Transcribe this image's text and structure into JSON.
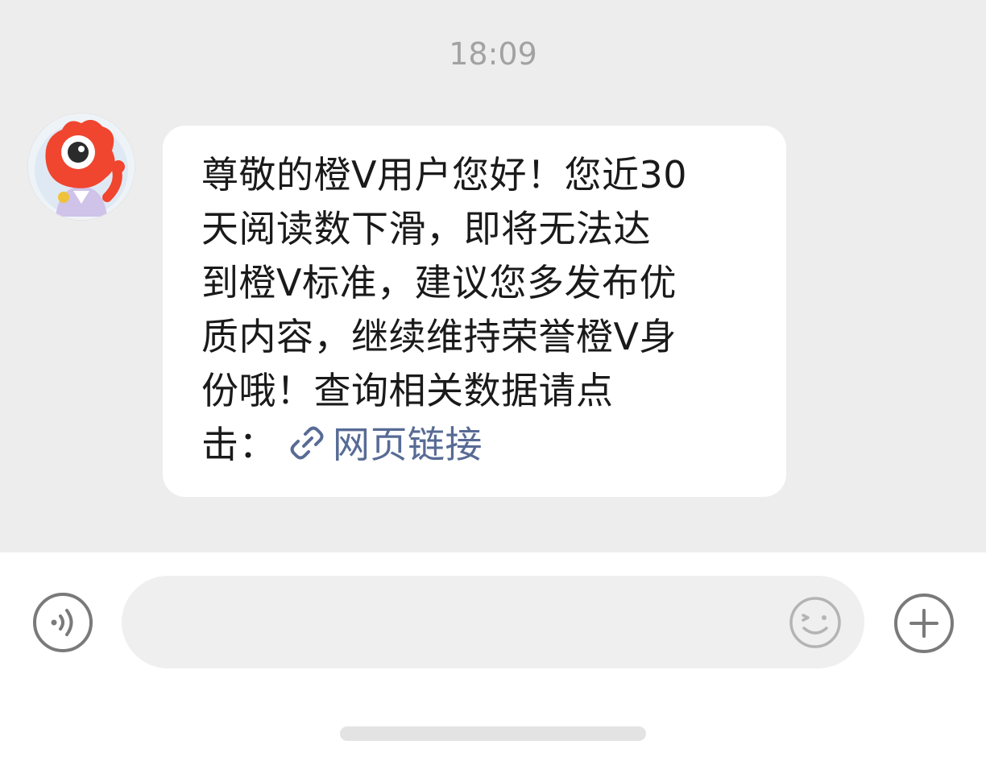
{
  "chat": {
    "timestamp": "18:09",
    "message": {
      "lines": [
        "尊敬的橙V用户您好！您近30",
        "天阅读数下滑，即将无法达",
        "到橙V标准，建议您多发布优",
        "质内容，继续维持荣誉橙V身",
        "份哦！查询相关数据请点"
      ],
      "last_line_prefix": "击：",
      "link_text": "网页链接",
      "link_icon": "link-icon"
    },
    "avatar_icon": "mascot-avatar"
  },
  "input_bar": {
    "placeholder": "",
    "voice_icon": "voice-icon",
    "emoji_icon": "emoji-icon",
    "plus_icon": "plus-icon"
  },
  "colors": {
    "chat_background": "#ededed",
    "bubble_background": "#ffffff",
    "link": "#576b95",
    "timestamp": "#a2a2a2",
    "input_field": "#efefef",
    "icon_gray": "#7a7a7a"
  }
}
